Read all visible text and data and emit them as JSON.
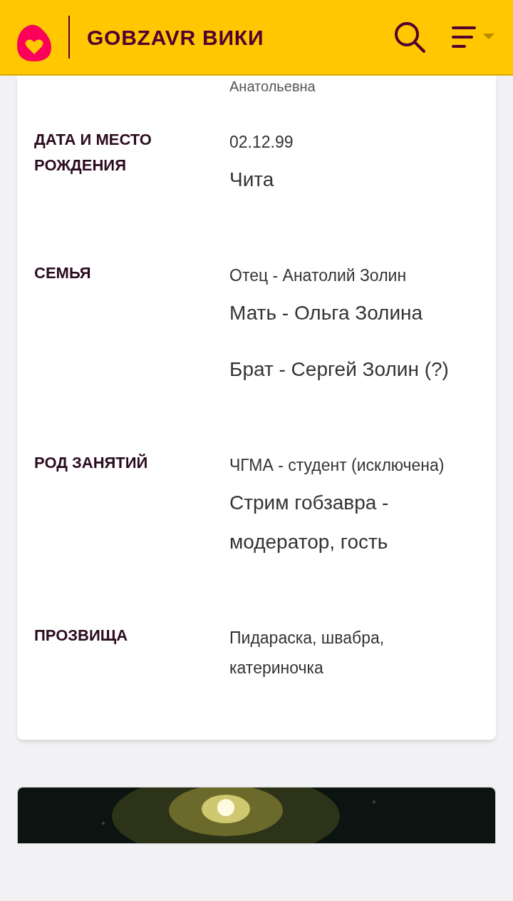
{
  "header": {
    "title": "GOBZAVR ВИКИ"
  },
  "cut_value": "Анатольевна",
  "rows": [
    {
      "label": "ДАТА И МЕСТО РОЖДЕНИЯ",
      "values": [
        {
          "kind": "small",
          "text": "02.12.99"
        },
        {
          "kind": "large",
          "text": "Чита"
        }
      ]
    },
    {
      "label": "СЕМЬЯ",
      "values": [
        {
          "kind": "small",
          "text": "Отец - Анатолий Золин"
        },
        {
          "kind": "large",
          "text": "Мать - Ольга Золина"
        },
        {
          "kind": "large",
          "text": "Брат - Сергей Золин (?)"
        }
      ]
    },
    {
      "label": "РОД ЗАНЯТИЙ",
      "values": [
        {
          "kind": "small",
          "text": "ЧГМА - студент (исключена)"
        },
        {
          "kind": "large",
          "text": "Стрим гобзавра - модератор, гость"
        }
      ]
    },
    {
      "label": "ПРОЗВИЩА",
      "values": [
        {
          "kind": "small",
          "text": "Пидараска, швабра, катериночка"
        }
      ]
    }
  ]
}
